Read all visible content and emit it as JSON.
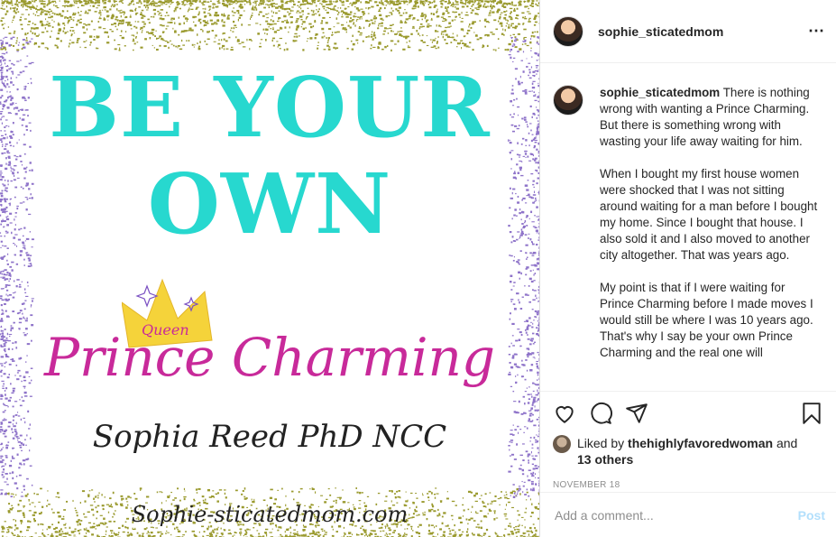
{
  "post": {
    "image": {
      "line1": "BE YOUR",
      "line2": "OWN",
      "crown_text": "Queen",
      "prince": "Prince Charming",
      "signature": "Sophia Reed PhD NCC",
      "site": "Sophie-sticatedmom.com",
      "colors": {
        "teal": "#27d8cf",
        "magenta": "#c82a9a",
        "crown": "#f5d33a",
        "gold_glitter": "#9a9a2e",
        "purple_glitter": "#8e73c9"
      }
    },
    "header": {
      "username": "sophie_sticatedmom",
      "more_icon": "⋯"
    },
    "caption": {
      "username": "sophie_sticatedmom",
      "p1": "There is nothing wrong with wanting a Prince Charming. But there is something wrong with wasting your life away waiting for him.",
      "p2": "When I bought my first house women were shocked that I was not sitting around waiting for a man before I bought my home. Since I bought that house. I also sold it and I also moved to another city altogether. That was years ago.",
      "p3": "My point is that if I were waiting for Prince Charming before I made moves I would still be where I was 10 years ago. That's why I say be your own Prince Charming and the real one will"
    },
    "likes": {
      "prefix": "Liked by",
      "user": "thehighlyfavoredwoman",
      "and": "and",
      "others": "13 others"
    },
    "date": "NOVEMBER 18",
    "comment": {
      "placeholder": "Add a comment...",
      "post_label": "Post"
    }
  }
}
